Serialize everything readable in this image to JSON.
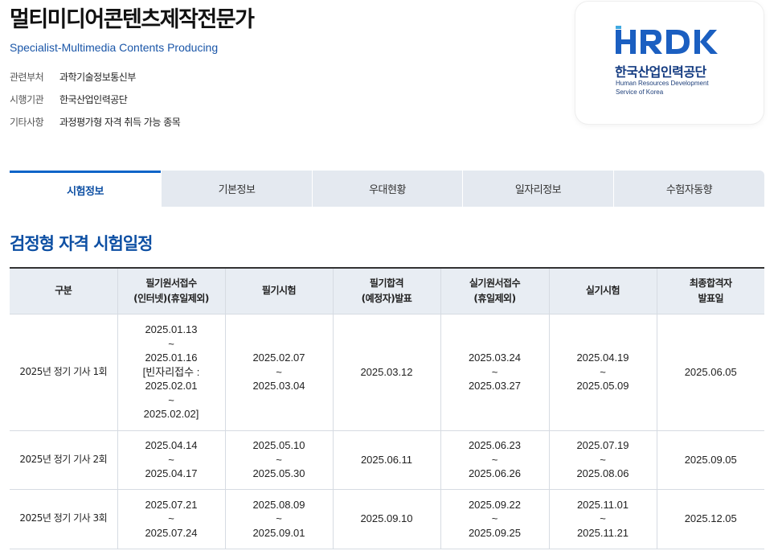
{
  "page": {
    "title": "멀티미디어콘텐츠제작전문가",
    "subtitle": "Specialist-Multimedia Contents Producing",
    "info": [
      {
        "label": "관련부처",
        "value": "과학기술정보통신부"
      },
      {
        "label": "시행기관",
        "value": "한국산업인력공단"
      },
      {
        "label": "기타사항",
        "value": "과정평가형 자격 취득 가능 종목"
      }
    ]
  },
  "logo": {
    "mark": "HRDK",
    "korean_name": "한국산업인력공단",
    "english_line1": "Human Resources Development",
    "english_line2": "Service of Korea",
    "colors": {
      "primary": "#1b5fc1",
      "accent": "#3fa9e0",
      "text": "#123a80"
    }
  },
  "tabs": [
    {
      "label": "시험정보",
      "active": true
    },
    {
      "label": "기본정보",
      "active": false
    },
    {
      "label": "우대현황",
      "active": false
    },
    {
      "label": "일자리정보",
      "active": false
    },
    {
      "label": "수험자동향",
      "active": false
    }
  ],
  "section": {
    "title": "검정형 자격 시험일정"
  },
  "table": {
    "headers": [
      [
        "구분"
      ],
      [
        "필기원서접수",
        "(인터넷)(휴일제외)"
      ],
      [
        "필기시험"
      ],
      [
        "필기합격",
        "(예정자)발표"
      ],
      [
        "실기원서접수",
        "(휴일제외)"
      ],
      [
        "실기시험"
      ],
      [
        "최종합격자",
        "발표일"
      ]
    ],
    "rows": [
      {
        "round": "2025년 정기 기사 1회",
        "written_apply": [
          "2025.01.13",
          "~",
          "2025.01.16",
          "[빈자리접수 :",
          "2025.02.01",
          "~",
          "2025.02.02]"
        ],
        "written_exam": [
          "2025.02.07",
          "~",
          "2025.03.04"
        ],
        "written_pass": [
          "2025.03.12"
        ],
        "practical_apply": [
          "2025.03.24",
          "~",
          "2025.03.27"
        ],
        "practical_exam": [
          "2025.04.19",
          "~",
          "2025.05.09"
        ],
        "final_pass": [
          "2025.06.05"
        ]
      },
      {
        "round": "2025년 정기 기사 2회",
        "written_apply": [
          "2025.04.14",
          "~",
          "2025.04.17"
        ],
        "written_exam": [
          "2025.05.10",
          "~",
          "2025.05.30"
        ],
        "written_pass": [
          "2025.06.11"
        ],
        "practical_apply": [
          "2025.06.23",
          "~",
          "2025.06.26"
        ],
        "practical_exam": [
          "2025.07.19",
          "~",
          "2025.08.06"
        ],
        "final_pass": [
          "2025.09.05"
        ]
      },
      {
        "round": "2025년 정기 기사 3회",
        "written_apply": [
          "2025.07.21",
          "~",
          "2025.07.24"
        ],
        "written_exam": [
          "2025.08.09",
          "~",
          "2025.09.01"
        ],
        "written_pass": [
          "2025.09.10"
        ],
        "practical_apply": [
          "2025.09.22",
          "~",
          "2025.09.25"
        ],
        "practical_exam": [
          "2025.11.01",
          "~",
          "2025.11.21"
        ],
        "final_pass": [
          "2025.12.05"
        ]
      }
    ]
  }
}
